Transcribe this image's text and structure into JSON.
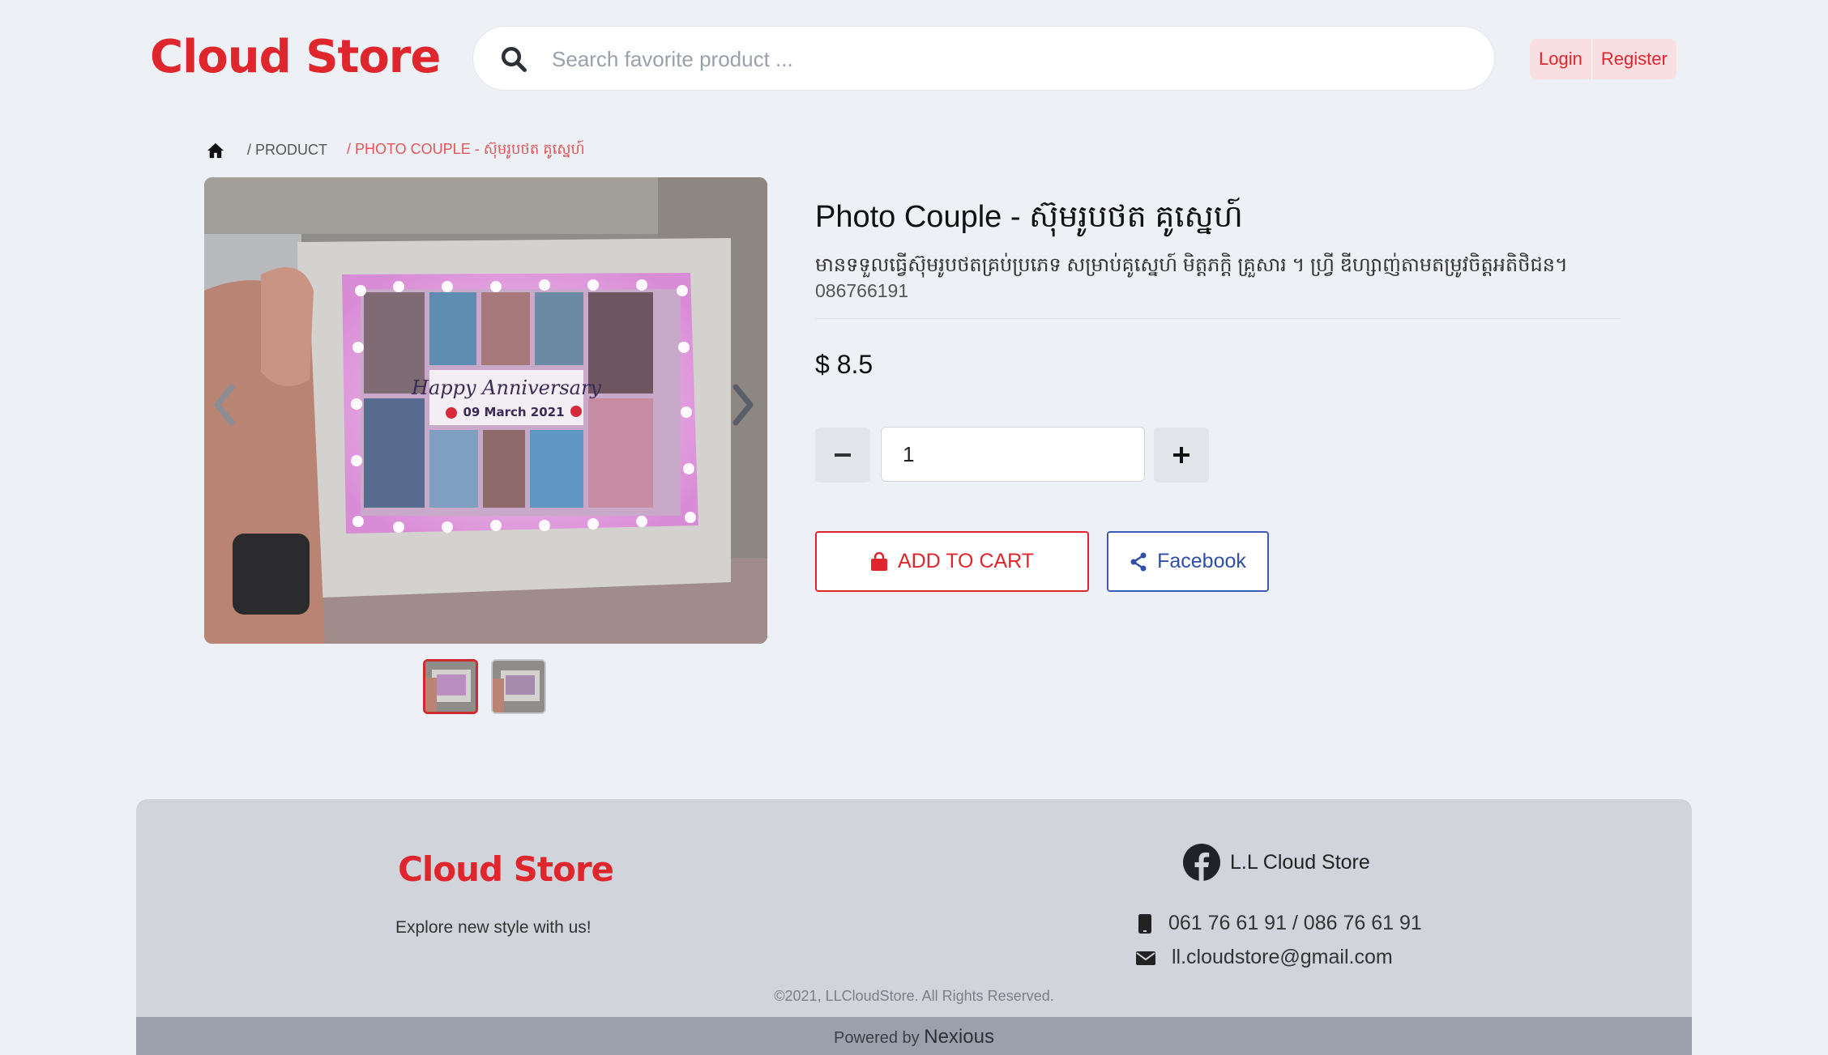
{
  "header": {
    "logo": "Cloud Store",
    "search_placeholder": "Search favorite product ...",
    "login": "Login",
    "register": "Register"
  },
  "breadcrumb": {
    "items": [
      "/ PRODUCT",
      "/ PHOTO COUPLE - ស៊ុមរូបថត គូស្នេហ៍"
    ]
  },
  "product": {
    "title": "Photo Couple - ស៊ុមរូបថត គូស្នេហ៍",
    "description": "មានទទួលធ្វើស៊ុមរូបថតគ្រប់ប្រភេទ សម្រាប់គូស្នេហ៍ មិត្តភក្តិ គ្រួសារ ។ ហ្វ្រី ឌីហ្សាញ់តាមតម្រូវចិត្តអតិថិជន។",
    "phone": "086766191",
    "price": "$ 8.5",
    "quantity": "1",
    "add_to_cart": "ADD TO CART",
    "share": "Facebook",
    "image_text_line1": "Happy Anniversary",
    "image_text_line2": "09 March 2021"
  },
  "footer": {
    "logo": "Cloud Store",
    "tagline": "Explore new style with us!",
    "facebook_page": "L.L Cloud Store",
    "phones": "061 76 61 91 / 086 76 61 91",
    "email": "ll.cloudstore@gmail.com",
    "copyright": "©2021, LLCloudStore. All Rights Reserved.",
    "powered_by_label": "Powered by",
    "powered_by_name": "Nexious"
  },
  "colors": {
    "brand_red": "#e0262d",
    "page_bg": "#edf0f4",
    "footer_bg": "#d1d4db",
    "facebook_blue": "#2f4fa8"
  }
}
